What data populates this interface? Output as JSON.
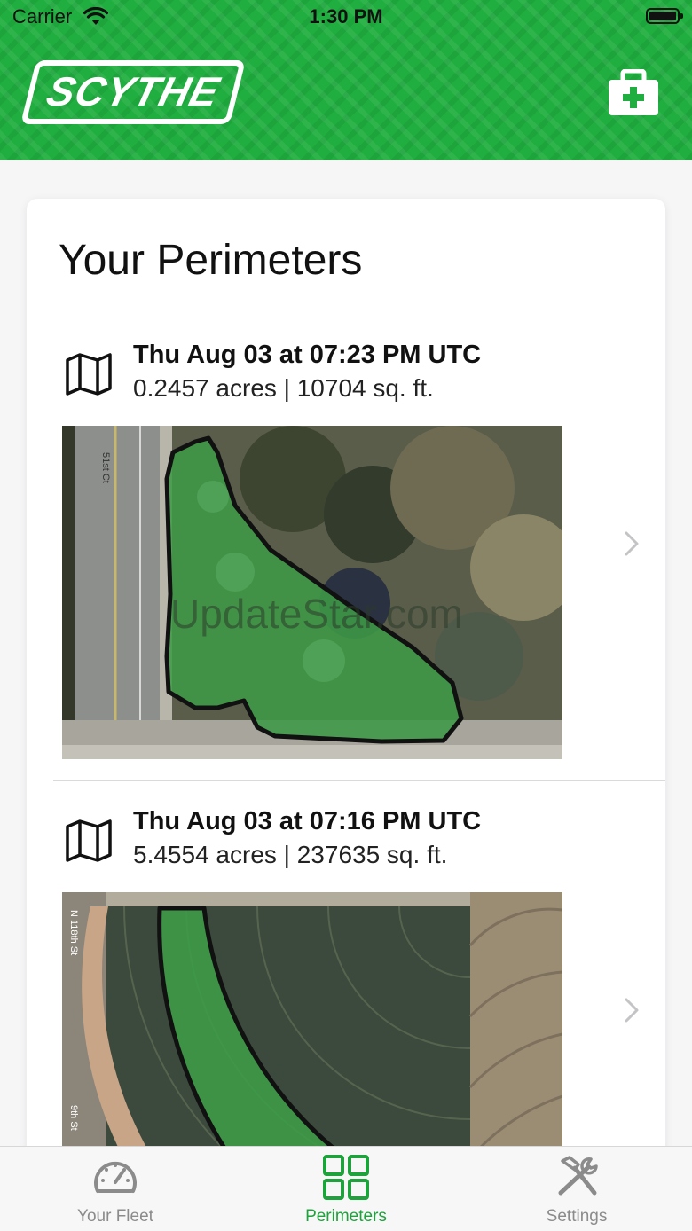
{
  "status_bar": {
    "carrier": "Carrier",
    "time": "1:30 PM"
  },
  "header": {
    "logo_text": "SCYTHE",
    "medkit_icon": "medkit-plus-icon"
  },
  "colors": {
    "brand_green": "#1fae3f",
    "tab_active": "#1ea23b",
    "tab_inactive": "#8b8b8b"
  },
  "page_title": "Your Perimeters",
  "perimeters": [
    {
      "date": "Thu Aug 03 at 07:23 PM UTC",
      "area": "0.2457 acres | 10704 sq. ft.",
      "watermark": "UpdateStar.com"
    },
    {
      "date": "Thu Aug 03 at 07:16 PM UTC",
      "area": "5.4554 acres | 237635 sq. ft.",
      "street_label": "N 118th St"
    }
  ],
  "street_labels": {
    "first": "51st Ct",
    "second_bottom": "9th St"
  },
  "tabs": [
    {
      "label": "Your Fleet",
      "icon": "speedometer-icon",
      "active": false
    },
    {
      "label": "Perimeters",
      "icon": "grid-icon",
      "active": true
    },
    {
      "label": "Settings",
      "icon": "tools-icon",
      "active": false
    }
  ]
}
